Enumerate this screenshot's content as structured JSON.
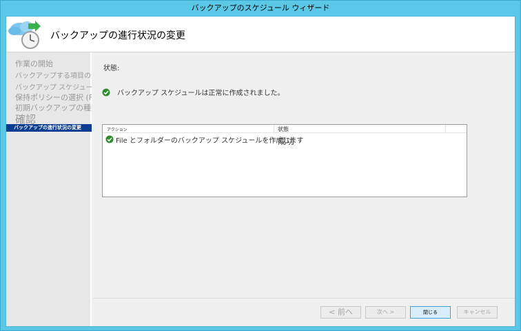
{
  "window": {
    "title": "バックアップのスケジュール ウィザード"
  },
  "header": {
    "title": "バックアップの進行状況の変更",
    "icon": "cloud-backup-clock-icon"
  },
  "nav": {
    "items": [
      {
        "label": "作業の開始"
      },
      {
        "label": "バックアップする項目の選択"
      },
      {
        "label": "バックアップ スケジュールの選択"
      },
      {
        "label": "保持ポリシーの選択 (F..."
      },
      {
        "label": "初期バックアップの種類を..."
      },
      {
        "label": "確認"
      },
      {
        "label": "バックアップの進行状況の変更",
        "active": true
      }
    ]
  },
  "main": {
    "status_label": "状態:",
    "status_message": "バックアップ スケジュールは正常に作成されました。",
    "grid": {
      "columns": [
        "アクション",
        "状態"
      ],
      "rows": [
        {
          "action": "File とフォルダーのバックアップ スケジュールを作成します",
          "status": "成功"
        }
      ]
    }
  },
  "buttons": {
    "back": "< 前へ",
    "next": "次へ >",
    "close": "閉じる",
    "cancel": "キャンセル"
  },
  "colors": {
    "titlebar": "#5bc8e8",
    "active_nav": "#0a3d91",
    "success": "#2e8b2e"
  }
}
